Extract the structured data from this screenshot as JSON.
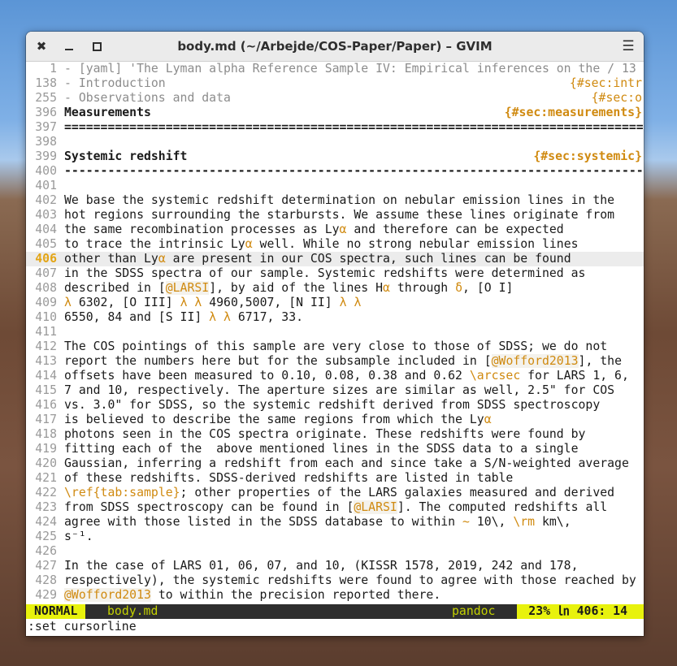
{
  "window": {
    "title": "body.md (~/Arbejde/COS-Paper/Paper) – GVIM",
    "close_glyph": "✖",
    "menu_glyph": "☰"
  },
  "colors": {
    "accent_orange": "#d08a10",
    "statusbar_yellow": "#e8f20d",
    "statusbar_bg": "#2e2e2e",
    "cursorline_bg": "#ececec"
  },
  "editor": {
    "lines": [
      {
        "n": "1",
        "kind": "fold",
        "text": "- [yaml] 'The Lyman alpha Reference Sample IV: Empirical inferences on the / 13"
      },
      {
        "n": "138",
        "kind": "fold",
        "text": "- Introduction",
        "tag": "{#sec:intr"
      },
      {
        "n": "255",
        "kind": "fold",
        "text": "- Observations and data",
        "tag": "{#sec:o"
      },
      {
        "n": "396",
        "kind": "head",
        "text": "Measurements",
        "tag": "{#sec:measurements}"
      },
      {
        "n": "397",
        "kind": "head",
        "text": "==================================================================================="
      },
      {
        "n": "398",
        "kind": "plain",
        "text": ""
      },
      {
        "n": "399",
        "kind": "head",
        "text": "Systemic redshift",
        "tag": "{#sec:systemic}"
      },
      {
        "n": "400",
        "kind": "head",
        "text": "-----------------------------------------------------------------------------------"
      },
      {
        "n": "401",
        "kind": "plain",
        "text": ""
      },
      {
        "n": "402",
        "kind": "plain",
        "text": "We base the systemic redshift determination on nebular emission lines in the"
      },
      {
        "n": "403",
        "kind": "plain",
        "text": "hot regions surrounding the starbursts. We assume these lines originate from"
      },
      {
        "n": "404",
        "kind": "plain",
        "text": "the same recombination processes as Lyα and therefore can be expected"
      },
      {
        "n": "405",
        "kind": "plain",
        "text": "to trace the intrinsic Lyα well. While no strong nebular emission lines"
      },
      {
        "n": "406",
        "kind": "cursor",
        "text": "other than Lyα are present in our COS spectra, such lines can be found"
      },
      {
        "n": "407",
        "kind": "plain",
        "text": "in the SDSS spectra of our sample. Systemic redshifts were determined as"
      },
      {
        "n": "408",
        "kind": "plain",
        "text": "described in [@LARSI], by aid of the lines Hα through δ, [O I]"
      },
      {
        "n": "409",
        "kind": "plain",
        "text": "λ 6302, [O III] λ λ 4960,5007, [N II] λ λ"
      },
      {
        "n": "410",
        "kind": "plain",
        "text": "6550, 84 and [S II] λ λ 6717, 33."
      },
      {
        "n": "411",
        "kind": "plain",
        "text": ""
      },
      {
        "n": "412",
        "kind": "plain",
        "text": "The COS pointings of this sample are very close to those of SDSS; we do not"
      },
      {
        "n": "413",
        "kind": "plain",
        "text": "report the numbers here but for the subsample included in [@Wofford2013], the"
      },
      {
        "n": "414",
        "kind": "plain",
        "text": "offsets have been measured to 0.10, 0.08, 0.38 and 0.62 \\arcsec for LARS 1, 6,"
      },
      {
        "n": "415",
        "kind": "plain",
        "text": "7 and 10, respectively. The aperture sizes are similar as well, 2.5\" for COS"
      },
      {
        "n": "416",
        "kind": "plain",
        "text": "vs. 3.0\" for SDSS, so the systemic redshift derived from SDSS spectroscopy"
      },
      {
        "n": "417",
        "kind": "plain",
        "text": "is believed to describe the same regions from which the Lyα"
      },
      {
        "n": "418",
        "kind": "plain",
        "text": "photons seen in the COS spectra originate. These redshifts were found by"
      },
      {
        "n": "419",
        "kind": "plain",
        "text": "fitting each of the  above mentioned lines in the SDSS data to a single"
      },
      {
        "n": "420",
        "kind": "plain",
        "text": "Gaussian, inferring a redshift from each and since take a S/N-weighted average"
      },
      {
        "n": "421",
        "kind": "plain",
        "text": "of these redshifts. SDSS-derived redshifts are listed in table"
      },
      {
        "n": "422",
        "kind": "plain",
        "text": "\\ref{tab:sample}; other properties of the LARS galaxies measured and derived"
      },
      {
        "n": "423",
        "kind": "plain",
        "text": "from SDSS spectroscopy can be found in [@LARSI]. The computed redshifts all"
      },
      {
        "n": "424",
        "kind": "plain",
        "text": "agree with those listed in the SDSS database to within ~ 10\\, \\rm km\\,"
      },
      {
        "n": "425",
        "kind": "plain",
        "text": "s⁻¹."
      },
      {
        "n": "426",
        "kind": "plain",
        "text": ""
      },
      {
        "n": "427",
        "kind": "plain",
        "text": "In the case of LARS 01, 06, 07, and 10, (KISSR 1578, 2019, 242 and 178,"
      },
      {
        "n": "428",
        "kind": "plain",
        "text": "respectively), the systemic redshifts were found to agree with those reached by"
      },
      {
        "n": "429",
        "kind": "plain",
        "text": "@Wofford2013 to within the precision reported there."
      }
    ]
  },
  "statusbar": {
    "mode": "NORMAL",
    "filename": "body.md",
    "filetype": "pandoc",
    "position": "23% ㏑ 406: 14"
  },
  "cmdline": {
    "text": ":set cursorline"
  }
}
